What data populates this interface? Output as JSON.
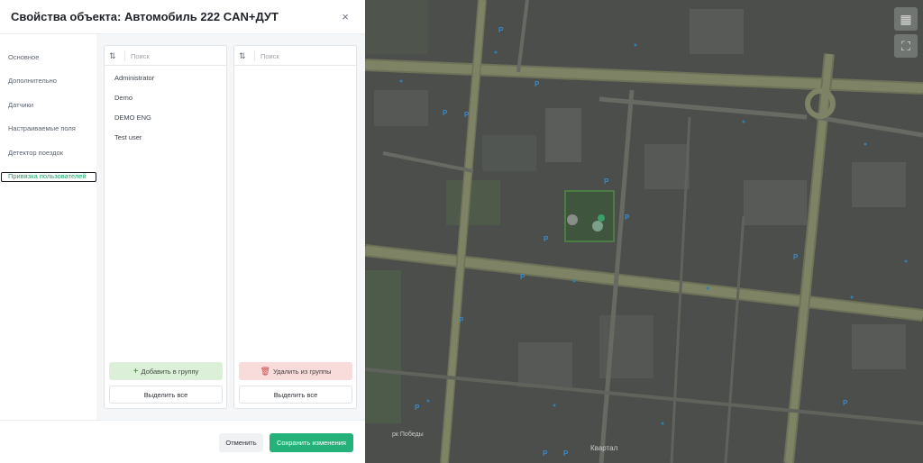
{
  "modal": {
    "title": "Свойства объекта: Автомобиль 222 CAN+ДУТ",
    "close_glyph": "×"
  },
  "sidebar": {
    "items": [
      {
        "label": "Основное"
      },
      {
        "label": "Дополнительно"
      },
      {
        "label": "Датчики"
      },
      {
        "label": "Настраиваемые поля"
      },
      {
        "label": "Детектор поездок"
      },
      {
        "label": "Привязка пользователей",
        "active": true
      }
    ]
  },
  "left_panel": {
    "search_placeholder": "Поиск",
    "users": [
      "Administrator",
      "Demo",
      "DEMO ENG",
      "Test user"
    ],
    "add_label": "Добавить в группу",
    "select_all_label": "Выделить все"
  },
  "right_panel": {
    "search_placeholder": "Поиск",
    "users": [],
    "remove_label": "Удалить из группы",
    "select_all_label": "Выделить все"
  },
  "footer": {
    "cancel_label": "Отменить",
    "save_label": "Сохранить изменения"
  },
  "map": {
    "labels": {
      "park": "рк Победы",
      "kvartal": "Квартал"
    },
    "icons": [
      "layers-icon",
      "fullscreen-icon"
    ]
  },
  "colors": {
    "accent": "#25b27a",
    "add_bg": "#dcefd9",
    "remove_bg": "#f8dcdc",
    "map_bg": "#4a4d4a"
  }
}
